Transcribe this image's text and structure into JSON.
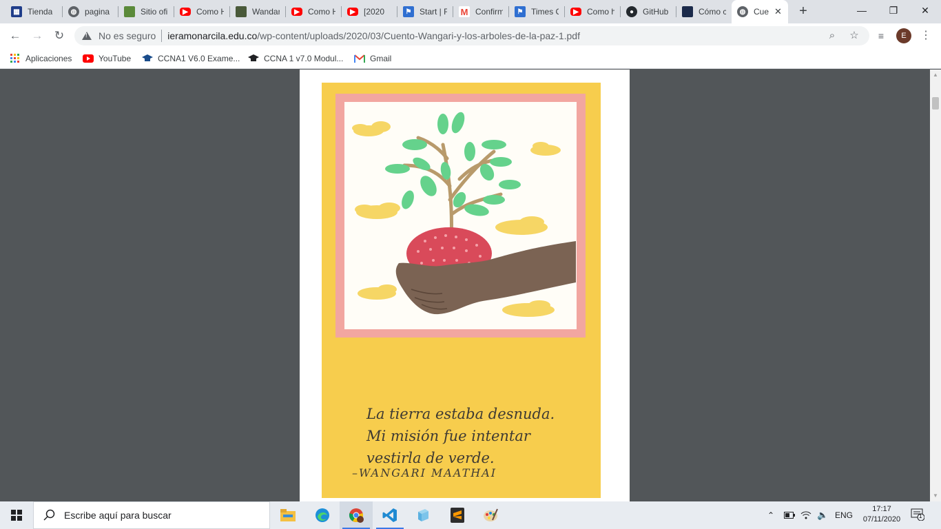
{
  "tabs": [
    {
      "title": "Tienda",
      "icon": "store-icon",
      "color": "#1f3d8a"
    },
    {
      "title": "pagina",
      "icon": "globe-icon",
      "color": "#5f6368"
    },
    {
      "title": "Sitio ofi",
      "icon": "minecraft-icon",
      "color": "#5b8a3a"
    },
    {
      "title": "Como H",
      "icon": "youtube-icon",
      "color": "#ff0000"
    },
    {
      "title": "Wandar",
      "icon": "picture-icon",
      "color": "#4a5a3a"
    },
    {
      "title": "Como H",
      "icon": "youtube-icon",
      "color": "#ff0000"
    },
    {
      "title": "[2020",
      "icon": "youtube-icon",
      "color": "#ff0000"
    },
    {
      "title": "Start | F",
      "icon": "flag-icon",
      "color": "#2f6fd1"
    },
    {
      "title": "Confirm",
      "icon": "gmail-icon",
      "color": "#ea4335"
    },
    {
      "title": "Times C",
      "icon": "flag-icon",
      "color": "#2f6fd1"
    },
    {
      "title": "Como h",
      "icon": "youtube-icon",
      "color": "#ff0000"
    },
    {
      "title": "GitHub",
      "icon": "github-icon",
      "color": "#24292e"
    },
    {
      "title": "Cómo c",
      "icon": "tutorial-icon",
      "color": "#1b2a4a"
    },
    {
      "title": "Cue",
      "icon": "globe-icon",
      "color": "#5f6368"
    }
  ],
  "omnibox": {
    "security_label": "No es seguro",
    "url_host": "ieramonarcila.edu.co",
    "url_path": "/wp-content/uploads/2020/03/Cuento-Wangari-y-los-arboles-de-la-paz-1.pdf"
  },
  "profile": {
    "initial": "E"
  },
  "bookmarks": [
    {
      "label": "Aplicaciones",
      "icon": "apps-grid-icon"
    },
    {
      "label": "YouTube",
      "icon": "youtube-icon"
    },
    {
      "label": "CCNA1 V6.0 Exame...",
      "icon": "graduation-cap-icon"
    },
    {
      "label": "CCNA 1 v7.0 Modul...",
      "icon": "graduation-cap-icon"
    },
    {
      "label": "Gmail",
      "icon": "gmail-icon"
    }
  ],
  "document": {
    "quote_lines": [
      "La tierra estaba desnuda.",
      "Mi misión fue intentar",
      "vestirla de verde."
    ],
    "author": "–WANGARI MAATHAI"
  },
  "taskbar": {
    "search_placeholder": "Escribe aquí para buscar",
    "apps": [
      "file-explorer-icon",
      "edge-icon",
      "chrome-icon",
      "vscode-icon",
      "app-cube-icon",
      "sublime-icon",
      "paint-icon"
    ],
    "language": "ENG",
    "time": "17:17",
    "date": "07/11/2020",
    "notification_count": "1"
  },
  "colors": {
    "tabstrip": "#dee1e6",
    "viewer_bg": "#525659",
    "art_yellow": "#f7cd4d",
    "art_frame_pink": "#f2a6a0",
    "taskbar": "#e8ecf1"
  }
}
